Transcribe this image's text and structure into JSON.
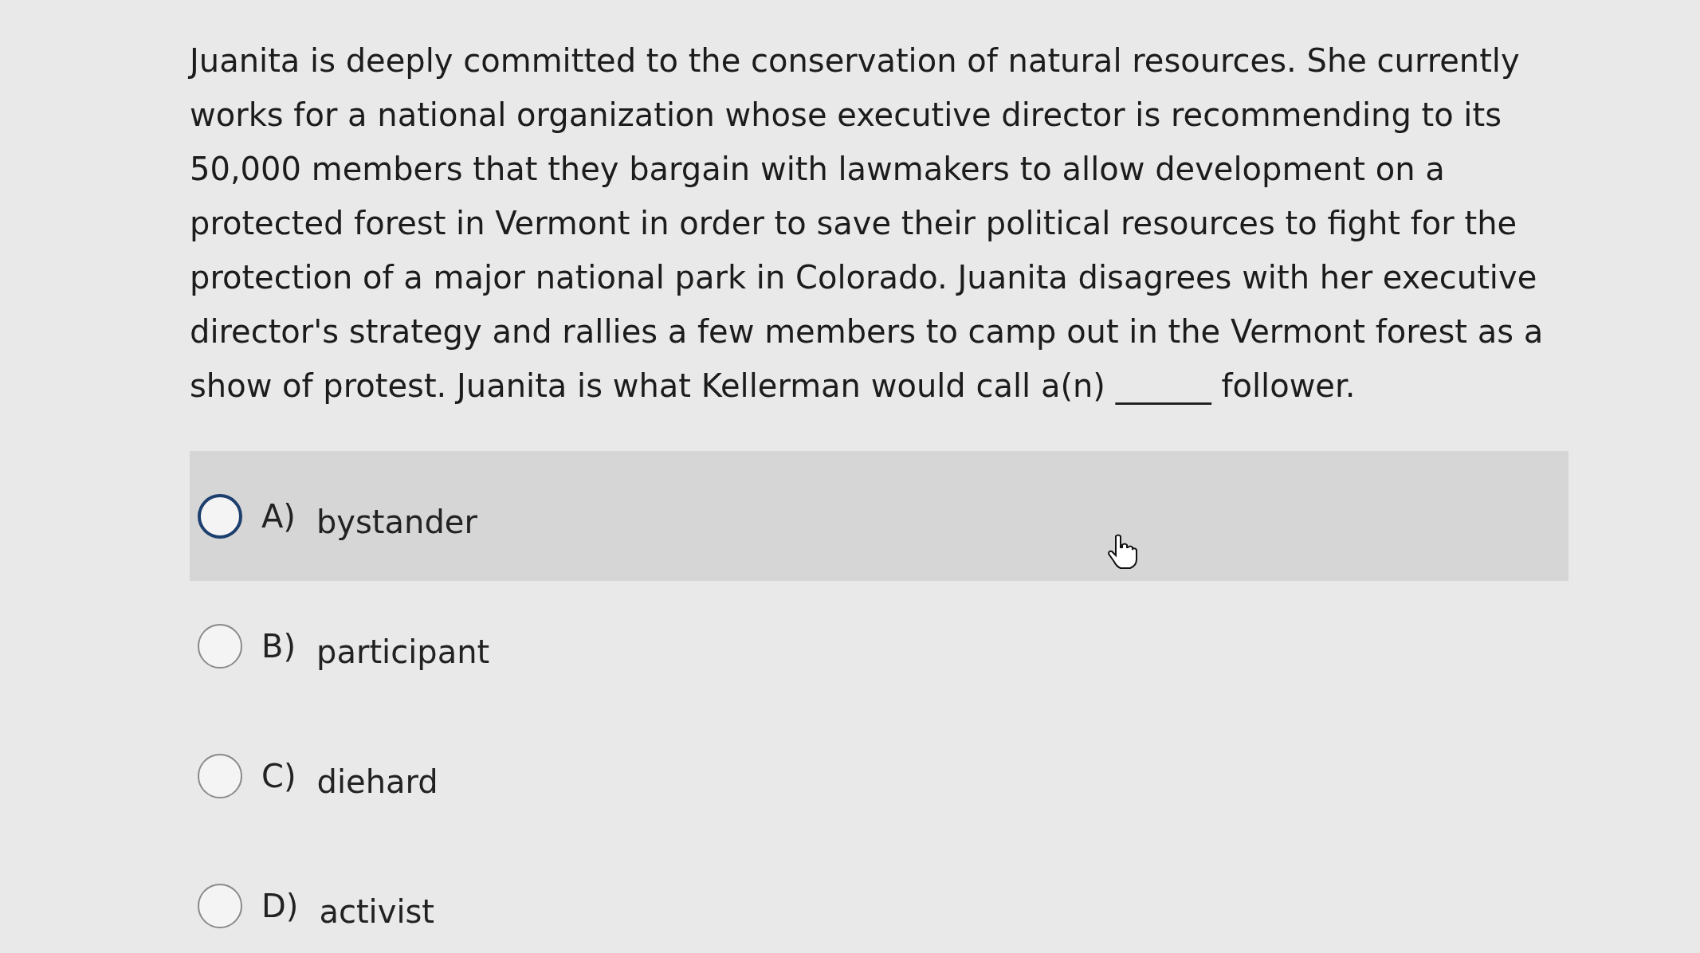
{
  "question": "Juanita is deeply committed to the conservation of natural resources. She currently works for a national organization whose executive director is recommending to its 50,000 members that they bargain with lawmakers to allow development on a protected forest in Vermont in order to save their political resources to fight for the protection of a major national park in Colorado. Juanita disagrees with her executive director's strategy and rallies a few members to camp out in the Vermont forest as a show of protest. Juanita is what Kellerman would call a(n) ______ follower.",
  "options": [
    {
      "letter": "A)",
      "text": "bystander",
      "selected": false,
      "hovered": true
    },
    {
      "letter": "B)",
      "text": "participant",
      "selected": false,
      "hovered": false
    },
    {
      "letter": "C)",
      "text": "diehard",
      "selected": false,
      "hovered": false
    },
    {
      "letter": "D)",
      "text": "activist",
      "selected": false,
      "hovered": false
    }
  ]
}
